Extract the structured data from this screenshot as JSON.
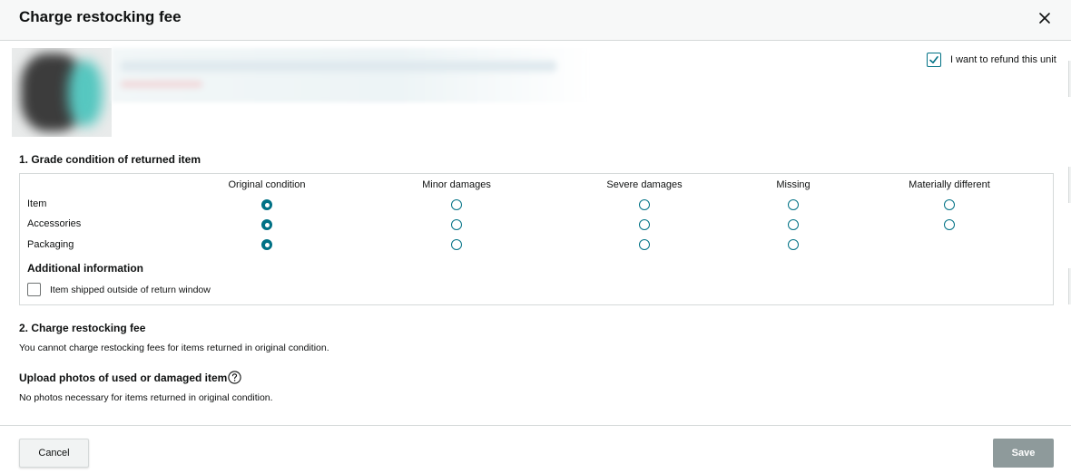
{
  "dialog": {
    "title": "Charge restocking fee",
    "close_icon": "close-icon"
  },
  "product": {
    "refund_label": "I want to refund this unit",
    "refund_checked": true
  },
  "grade": {
    "heading": "1. Grade condition of returned item",
    "columns": [
      "Original condition",
      "Minor damages",
      "Severe damages",
      "Missing",
      "Materially different"
    ],
    "rows": [
      {
        "label": "Item",
        "options": 5,
        "selected": "Original condition"
      },
      {
        "label": "Accessories",
        "options": 5,
        "selected": "Original condition"
      },
      {
        "label": "Packaging",
        "options": 4,
        "selected": "Original condition"
      }
    ],
    "additional_heading": "Additional information",
    "shipped_outside_label": "Item shipped outside of return window",
    "shipped_outside_checked": false
  },
  "restocking": {
    "heading": "2. Charge restocking fee",
    "note": "You cannot charge restocking fees for items returned in original condition."
  },
  "photos": {
    "heading": "Upload photos of used or damaged item",
    "help_icon": "question-circle-icon",
    "note": "No photos necessary for items returned in original condition."
  },
  "footer": {
    "cancel_label": "Cancel",
    "save_label": "Save"
  },
  "colors": {
    "accent": "#007185",
    "save_disabled": "#8e9a9b",
    "border": "#d5d9d9"
  }
}
